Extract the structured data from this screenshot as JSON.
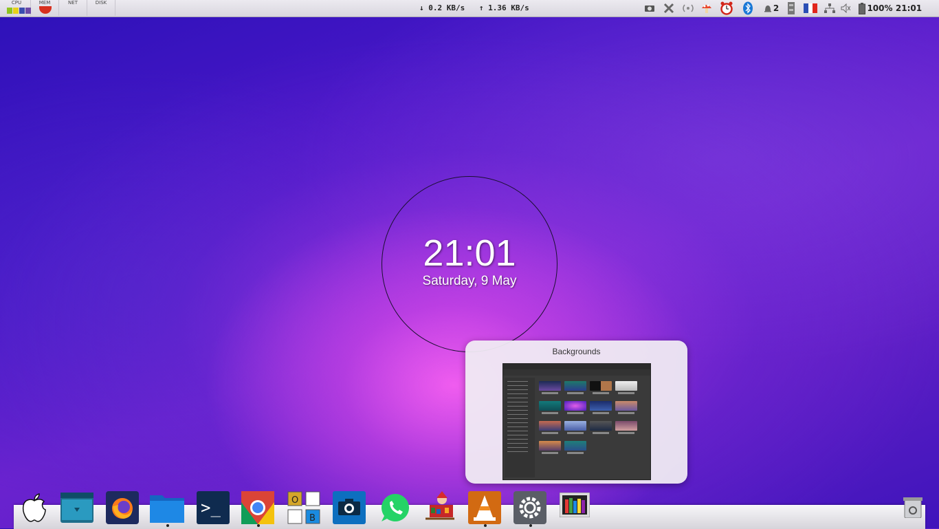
{
  "top_panel": {
    "monitors": {
      "cpu_label": "CPU",
      "mem_label": "MEM",
      "net_label": "NET",
      "disk_label": "DISK"
    },
    "netspeed": {
      "download": "↓ 0.2 KB/s",
      "upload": "↑ 1.36 KB/s"
    },
    "tray": {
      "icons": [
        "screenshot-icon",
        "x-icon",
        "wireless-icon",
        "mushroom-icon",
        "alarm-clock-icon",
        "bluetooth-icon",
        "notification-bell-icon",
        "memory-icon",
        "french-flag-icon",
        "network-icon",
        "volume-muted-icon",
        "battery-icon"
      ],
      "notification_count": "2",
      "battery_level": "100%",
      "clock": "21:01"
    }
  },
  "clock_widget": {
    "time": "21:01",
    "date": "Saturday, 9 May"
  },
  "window_preview": {
    "title": "Backgrounds"
  },
  "dock": {
    "items": [
      {
        "name": "apple-menu-icon"
      },
      {
        "name": "desktop-icon"
      },
      {
        "name": "firefox-icon"
      },
      {
        "name": "files-icon"
      },
      {
        "name": "terminal-icon"
      },
      {
        "name": "chrome-icon"
      },
      {
        "name": "office-suite-icon"
      },
      {
        "name": "camera-icon"
      },
      {
        "name": "whatsapp-icon"
      },
      {
        "name": "santa-sleigh-icon"
      },
      {
        "name": "vlc-icon"
      },
      {
        "name": "settings-icon"
      },
      {
        "name": "backgrounds-icon"
      },
      {
        "name": "trash-icon"
      }
    ],
    "terminal_glyph": ">_",
    "office_letters": [
      "O",
      "B"
    ]
  },
  "colors": {
    "wallpaper_top": "#2c11b8",
    "wallpaper_glow": "#f55ff0",
    "panel": "#e4e2e8"
  }
}
